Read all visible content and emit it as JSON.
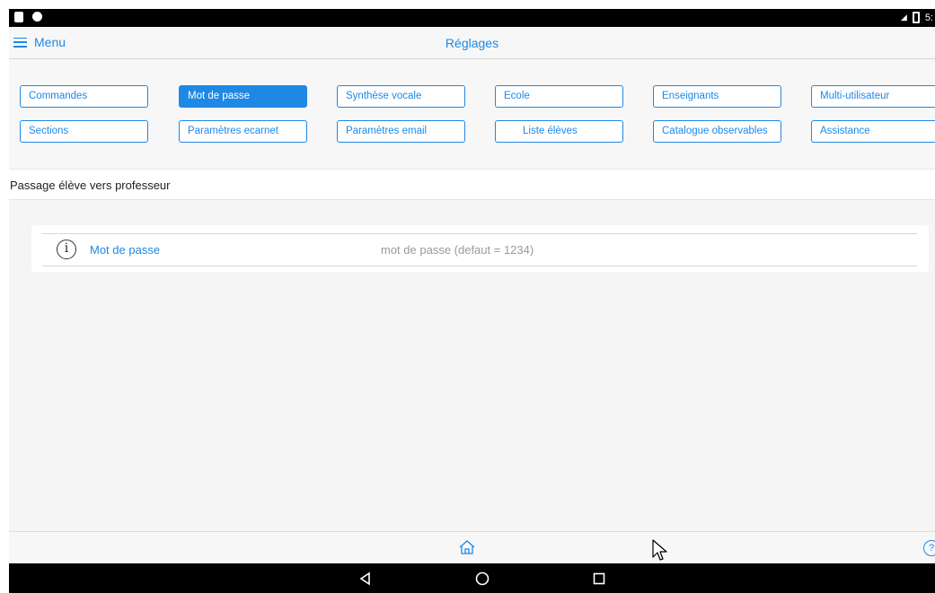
{
  "header": {
    "menu_label": "Menu",
    "title": "Réglages"
  },
  "tabs": [
    {
      "label": "Commandes",
      "active": false
    },
    {
      "label": "Mot de passe",
      "active": true
    },
    {
      "label": "Synthèse vocale",
      "active": false
    },
    {
      "label": "Ecole",
      "active": false
    },
    {
      "label": "Enseignants",
      "active": false
    },
    {
      "label": "Multi-utilisateur",
      "active": false
    },
    {
      "label": "Sections",
      "active": false
    },
    {
      "label": "Paramètres ecarnet",
      "active": false
    },
    {
      "label": "Paramètres email",
      "active": false
    },
    {
      "label": "Liste élèves",
      "active": false
    },
    {
      "label": "Catalogue observables",
      "active": false
    },
    {
      "label": "Assistance",
      "active": false
    }
  ],
  "section": {
    "title": "Passage élève vers professeur"
  },
  "password_field": {
    "label": "Mot de passe",
    "placeholder": "mot de passe (defaut = 1234)",
    "value": ""
  },
  "icons": {
    "info": "info-icon",
    "home": "home-icon",
    "help": "help-icon",
    "menu": "hamburger-icon",
    "back": "back-icon",
    "nav_home": "circle-home-icon",
    "recents": "recents-icon"
  },
  "status_bar": {
    "time": "5:"
  },
  "colors": {
    "accent": "#1e88e5",
    "placeholder": "#9a9a9a",
    "background": "#f5f5f5"
  }
}
